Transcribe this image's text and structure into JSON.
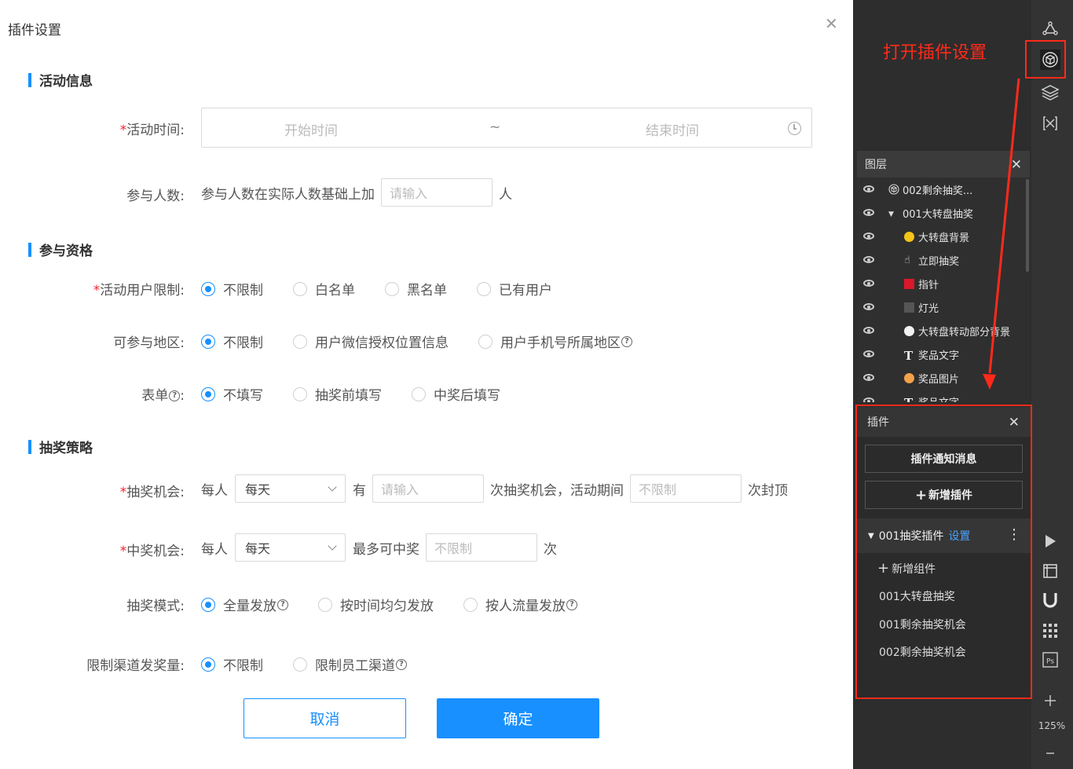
{
  "dialog": {
    "title": "插件设置",
    "sections": {
      "info": "活动信息",
      "eligibility": "参与资格",
      "strategy": "抽奖策略"
    },
    "activity_time": {
      "label": "活动时间:",
      "start_placeholder": "开始时间",
      "sep": "~",
      "end_placeholder": "结束时间"
    },
    "participants": {
      "label": "参与人数:",
      "prefix": "参与人数在实际人数基础上加",
      "placeholder": "请输入",
      "suffix": "人"
    },
    "user_limit": {
      "label": "活动用户限制:",
      "options": [
        "不限制",
        "白名单",
        "黑名单",
        "已有用户"
      ],
      "selected": 0
    },
    "region": {
      "label": "可参与地区:",
      "options": [
        "不限制",
        "用户微信授权位置信息",
        "用户手机号所属地区"
      ],
      "selected": 0
    },
    "form": {
      "label": "表单",
      "colon": ":",
      "options": [
        "不填写",
        "抽奖前填写",
        "中奖后填写"
      ],
      "selected": 0
    },
    "draw_chance": {
      "label": "抽奖机会:",
      "per": "每人",
      "period": "每天",
      "have": "有",
      "placeholder": "请输入",
      "mid": "次抽奖机会，活动期间",
      "limit_placeholder": "不限制",
      "suffix": "次封顶"
    },
    "win_chance": {
      "label": "中奖机会:",
      "per": "每人",
      "period": "每天",
      "max": "最多可中奖",
      "placeholder": "不限制",
      "suffix": "次"
    },
    "draw_mode": {
      "label": "抽奖模式:",
      "options": [
        "全量发放",
        "按时间均匀发放",
        "按人流量发放"
      ],
      "selected": 0
    },
    "channel_limit": {
      "label": "限制渠道发奖量:",
      "options": [
        "不限制",
        "限制员工渠道"
      ],
      "selected": 0
    },
    "cancel_label": "取消",
    "ok_label": "确定"
  },
  "annotation": "打开插件设置",
  "layers_panel": {
    "title": "图层",
    "items": [
      {
        "name": "002剩余抽奖...",
        "indent": 0,
        "icon": "cube-icon"
      },
      {
        "name": "001大转盘抽奖",
        "indent": 0,
        "icon": "caret-down-icon"
      },
      {
        "name": "大转盘背景",
        "indent": 1,
        "icon": "yellow-circle-icon"
      },
      {
        "name": "立即抽奖",
        "indent": 1,
        "icon": "hand-icon"
      },
      {
        "name": "指针",
        "indent": 1,
        "icon": "red-pointer-icon"
      },
      {
        "name": "灯光",
        "indent": 1,
        "icon": "gray-square-icon"
      },
      {
        "name": "大转盘转动部分背景",
        "indent": 1,
        "icon": "white-circle-icon"
      },
      {
        "name": "奖品文字",
        "indent": 1,
        "icon": "text-icon"
      },
      {
        "name": "奖品图片",
        "indent": 1,
        "icon": "image-icon"
      },
      {
        "name": "奖品文字",
        "indent": 1,
        "icon": "text-icon"
      }
    ]
  },
  "plugins_panel": {
    "title": "插件",
    "notify_button": "插件通知消息",
    "add_plugin_button": "新增插件",
    "group_name": "001抽奖插件",
    "group_link": "设置",
    "add_component": "新增组件",
    "items": [
      "001大转盘抽奖",
      "001剩余抽奖机会",
      "002剩余抽奖机会"
    ]
  },
  "toolbar": {
    "zoom": "125%",
    "ps_label": "Ps"
  },
  "colors": {
    "primary": "#1890ff",
    "annotation_red": "#ff2a1a",
    "dark_bg": "#2d2d2d"
  }
}
